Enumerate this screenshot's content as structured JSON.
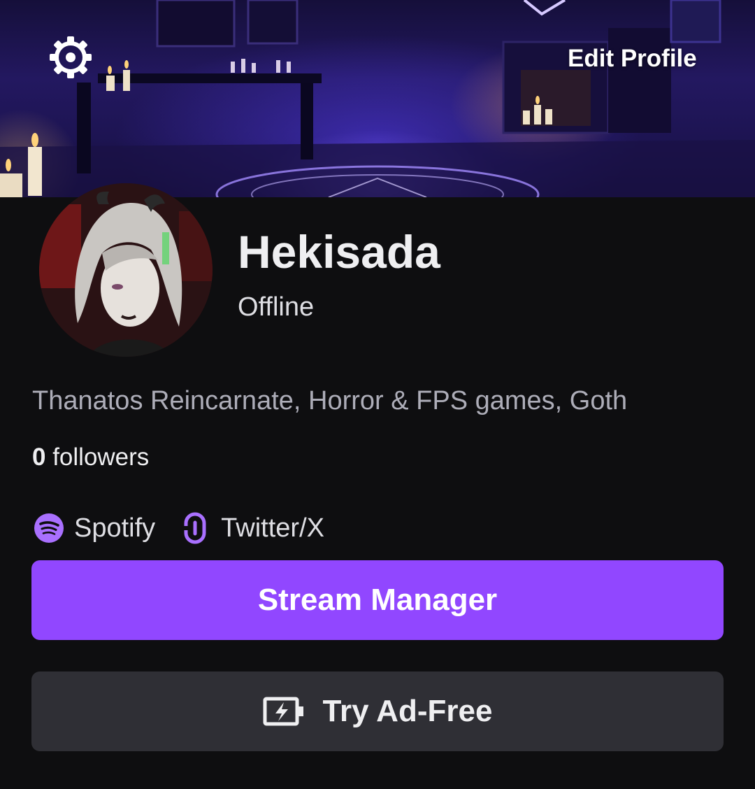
{
  "header": {
    "settings_icon": "gear-icon",
    "edit_profile_label": "Edit Profile"
  },
  "profile": {
    "display_name": "Hekisada",
    "status": "Offline",
    "bio": "Thanatos Reincarnate, Horror & FPS games, Goth",
    "followers_count": "0",
    "followers_label": "followers"
  },
  "social_links": [
    {
      "label": "Spotify",
      "icon": "spotify-icon"
    },
    {
      "label": "Twitter/X",
      "icon": "link-icon"
    }
  ],
  "actions": {
    "stream_manager_label": "Stream Manager",
    "try_ad_free_label": "Try Ad-Free",
    "try_ad_free_icon": "battery-bolt-icon"
  },
  "colors": {
    "accent": "#9147ff",
    "background": "#0e0e10",
    "secondary_button": "#2f2f35"
  }
}
